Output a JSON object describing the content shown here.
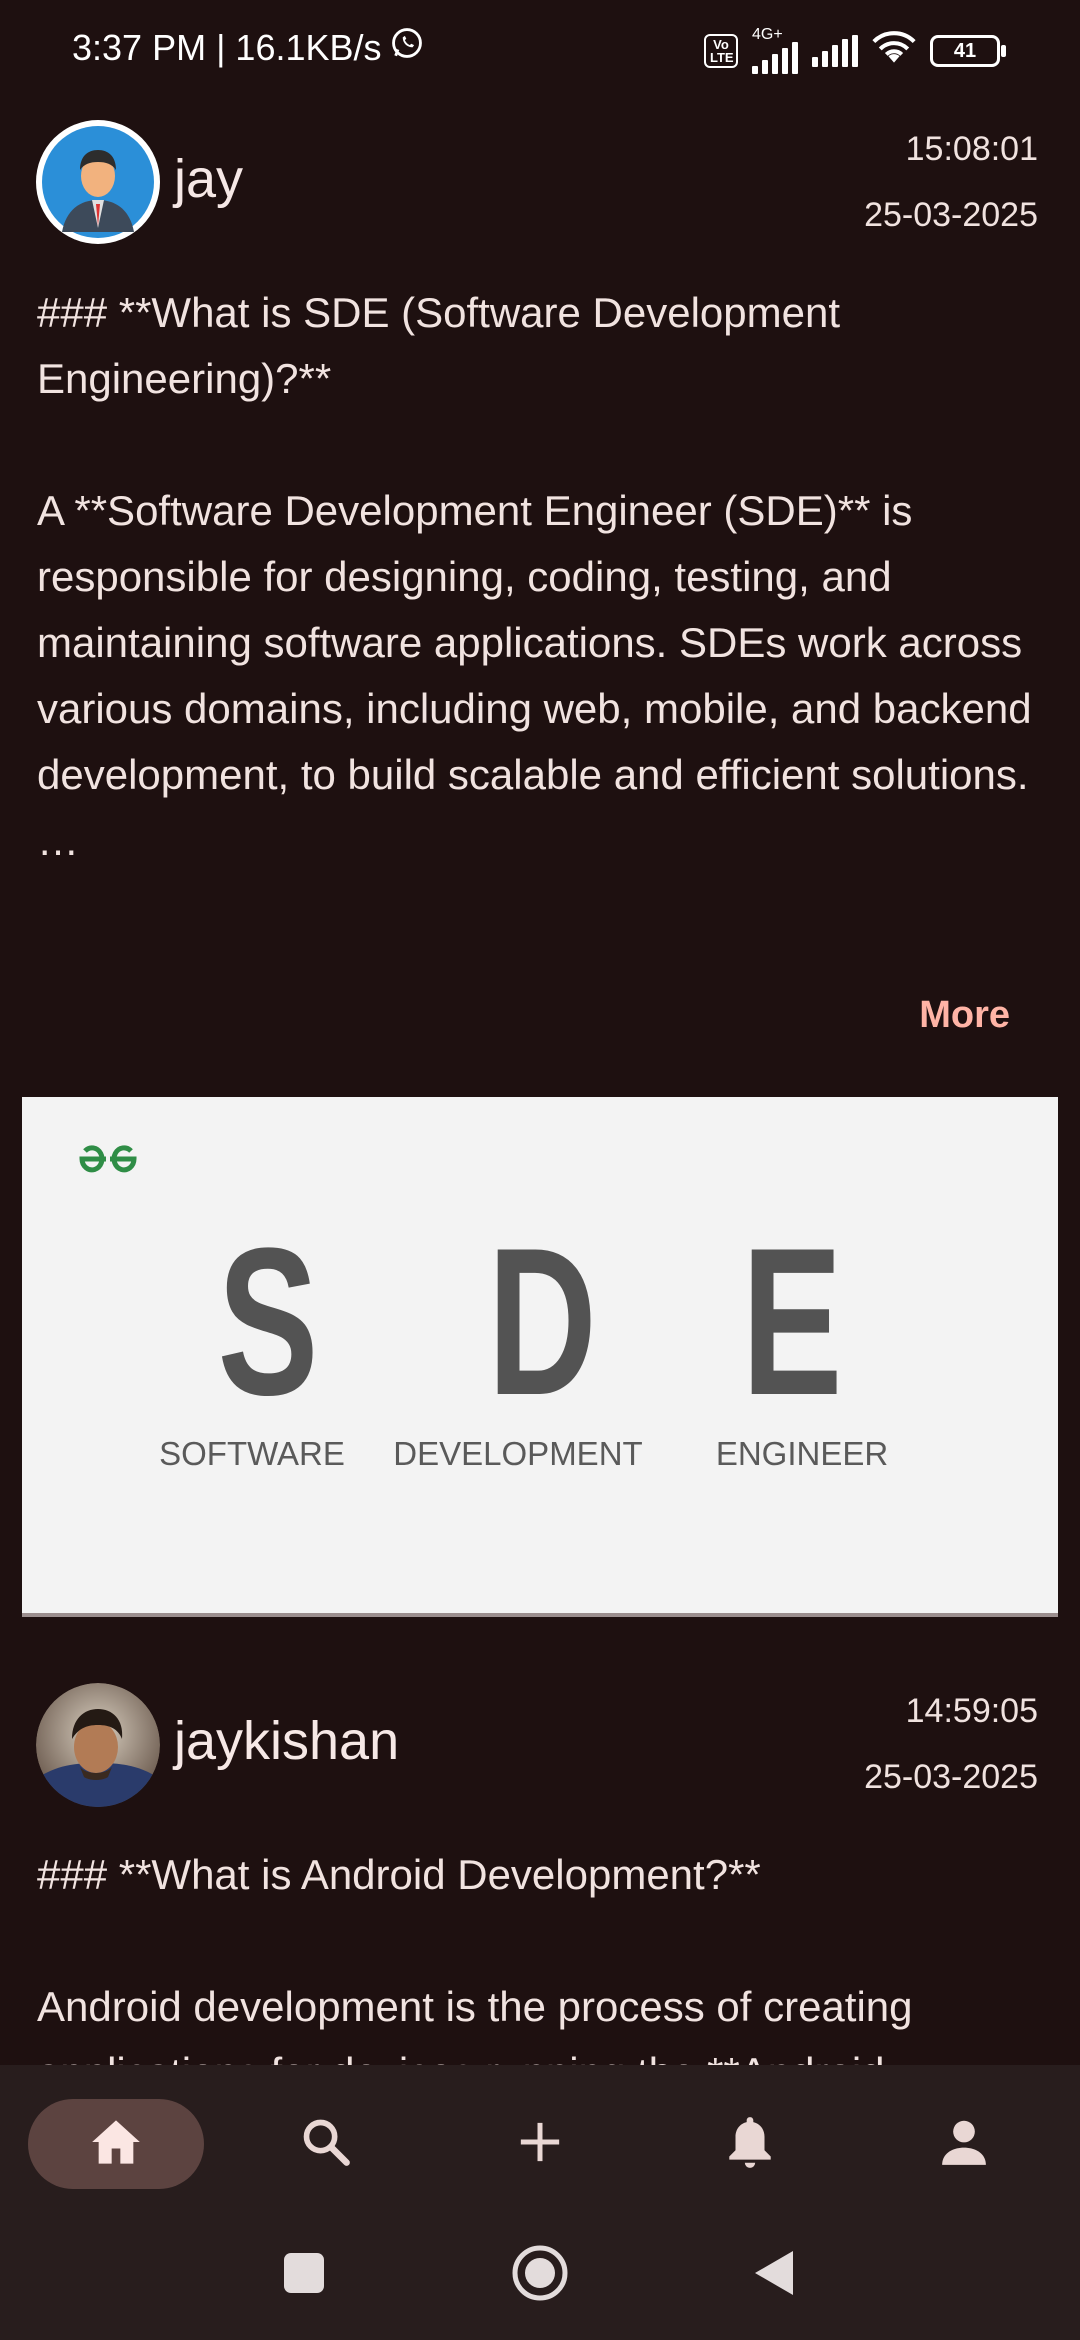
{
  "status_bar": {
    "time_speed": "3:37 PM | 16.1KB/s",
    "volte": "Vo LTE",
    "network": "4G+",
    "battery": "41"
  },
  "posts": [
    {
      "username": "jay",
      "time": "15:08:01",
      "date": "25-03-2025",
      "text": "### **What is SDE (Software Development Engineering)?**\n\nA **Software Development Engineer (SDE)** is responsible for designing, coding, testing, and maintaining software applications. SDEs work across various domains, including web, mobile, and backend development, to build scalable and efficient solutions.\n…",
      "more_label": "More",
      "image": {
        "letters": [
          "S",
          "D",
          "E"
        ],
        "words": [
          "SOFTWARE",
          "DEVELOPMENT",
          "ENGINEER"
        ]
      }
    },
    {
      "username": "jaykishan",
      "time": "14:59:05",
      "date": "25-03-2025",
      "text": "### **What is Android Development?**\n\nAndroid development is the process of creating applications for devices running the **Android"
    }
  ],
  "bottom_nav": {
    "items": [
      {
        "name": "home",
        "icon": "home-icon",
        "active": true
      },
      {
        "name": "search",
        "icon": "search-icon",
        "active": false
      },
      {
        "name": "add",
        "icon": "plus-icon",
        "active": false
      },
      {
        "name": "notifications",
        "icon": "bell-icon",
        "active": false
      },
      {
        "name": "profile",
        "icon": "person-icon",
        "active": false
      }
    ]
  },
  "colors": {
    "background": "#1e1010",
    "accent": "#ffb4a6",
    "nav_active": "#5c4340",
    "nav_bg": "#281d1d"
  }
}
